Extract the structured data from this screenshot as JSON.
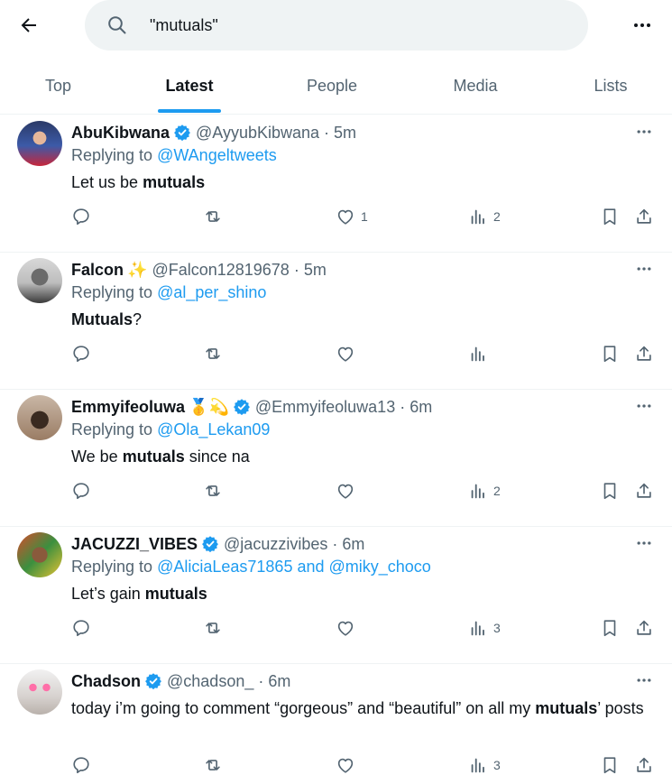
{
  "search": {
    "value": "\"mutuals\""
  },
  "tabs": [
    "Top",
    "Latest",
    "People",
    "Media",
    "Lists"
  ],
  "active_tab": "Latest",
  "tweets": [
    {
      "name": "AbuKibwana",
      "handle": "@AyyubKibwana",
      "time": "· 5m",
      "verified": true,
      "emojis": "",
      "reply_prefix": "Replying to",
      "reply_to": "@WAngeltweets",
      "text_before": "Let us be ",
      "text_bold": "mutuals",
      "text_after": "",
      "likes": "1",
      "views": "2"
    },
    {
      "name": "Falcon",
      "handle": "@Falcon12819678",
      "time": "· 5m",
      "verified": false,
      "emojis": "✨",
      "reply_prefix": "Replying to",
      "reply_to": "@al_per_shino",
      "text_before": "",
      "text_bold": "Mutuals",
      "text_after": "?",
      "likes": "",
      "views": ""
    },
    {
      "name": "Emmyifeoluwa",
      "handle": "@Emmyifeoluwa13",
      "time": "· 6m",
      "verified": true,
      "emojis": "🥇💫",
      "reply_prefix": "Replying to",
      "reply_to": "@Ola_Lekan09",
      "text_before": "We be ",
      "text_bold": "mutuals",
      "text_after": " since na",
      "likes": "",
      "views": "2"
    },
    {
      "name": "JACUZZI_VIBES",
      "handle": "@jacuzzivibes",
      "time": "· 6m",
      "verified": true,
      "emojis": "",
      "reply_prefix": "Replying to",
      "reply_to": "@AliciaLeas71865 and @miky_choco",
      "text_before": "Let’s gain ",
      "text_bold": "mutuals",
      "text_after": "",
      "likes": "",
      "views": "3"
    },
    {
      "name": "Chadson",
      "handle": "@chadson_",
      "time": "· 6m",
      "verified": true,
      "emojis": "",
      "reply_prefix": "",
      "reply_to": "",
      "text_before": "today i’m going to comment “gorgeous” and “beautiful” on all my ",
      "text_bold": "mutuals",
      "text_after": "’ posts",
      "likes": "",
      "views": "3"
    }
  ],
  "colors": {
    "accent": "#1d9bf0",
    "text": "#0f1419",
    "muted": "#536471",
    "search_bg": "#eff3f4"
  },
  "icons": [
    "back-arrow-icon",
    "search-icon",
    "more-icon",
    "verified-badge-icon",
    "reply-icon",
    "retweet-icon",
    "like-icon",
    "views-icon",
    "bookmark-icon",
    "share-icon"
  ]
}
